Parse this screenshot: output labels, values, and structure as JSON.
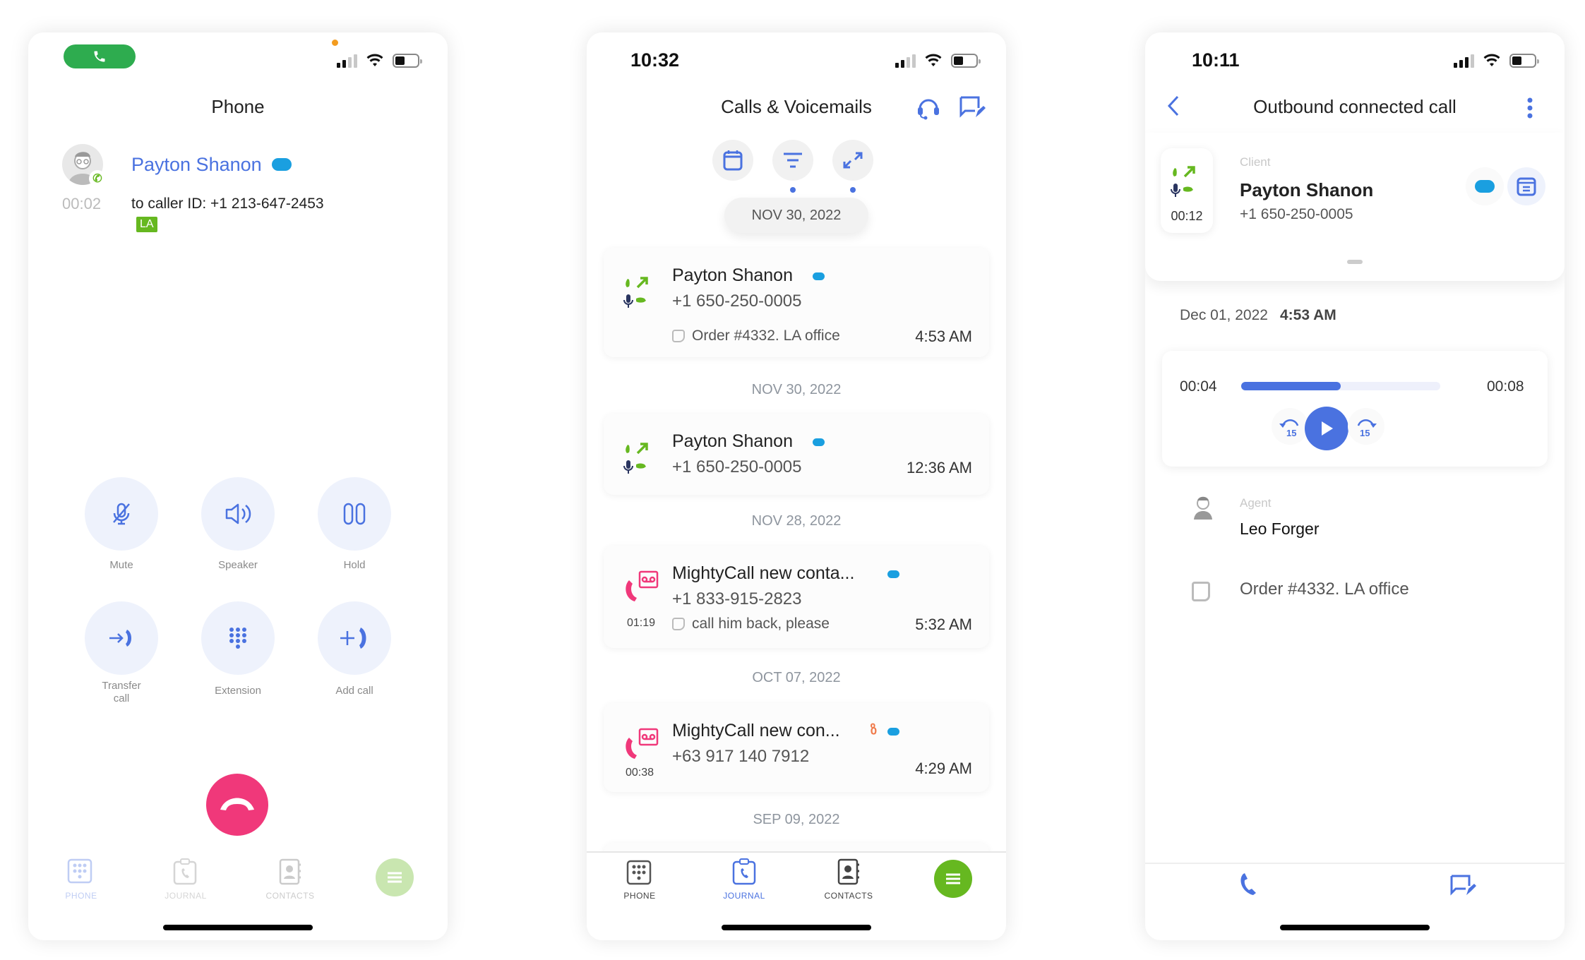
{
  "panel_call": {
    "status_bar": {
      "call_indicator": "phone-icon"
    },
    "title": "Phone",
    "contact": {
      "name": "Payton Shanon",
      "crm": "salesforce-icon",
      "duration": "00:02",
      "caller_id": "to caller ID: +1 213-647-2453",
      "tag": "LA"
    },
    "controls": [
      {
        "label": "Mute",
        "icon": "mic-off-icon"
      },
      {
        "label": "Speaker",
        "icon": "speaker-icon"
      },
      {
        "label": "Hold",
        "icon": "pause-icon"
      },
      {
        "label": "Transfer call",
        "icon": "transfer-icon"
      },
      {
        "label": "Extension",
        "icon": "keypad-icon"
      },
      {
        "label": "Add call",
        "icon": "add-call-icon"
      }
    ],
    "end_call": "hangup-icon",
    "tabs": [
      {
        "label": "PHONE"
      },
      {
        "label": "JOURNAL"
      },
      {
        "label": "CONTACTS"
      }
    ],
    "menu": "menu-icon"
  },
  "panel_journal": {
    "status_bar": {
      "time": "10:32"
    },
    "title": "Calls & Voicemails",
    "filters": [
      "calendar-icon",
      "filter-icon",
      "direction-icon"
    ],
    "sticky_date": "NOV 30, 2022",
    "items": [
      {
        "name": "Payton Shanon",
        "number": "+1 650-250-0005",
        "note": "Order #4332. LA office",
        "time": "4:53 AM",
        "type": "outbound-connected",
        "crm": [
          "salesforce"
        ]
      },
      {
        "date": "NOV 30, 2022",
        "name": "Payton Shanon",
        "number": "+1 650-250-0005",
        "time": "12:36 AM",
        "type": "outbound-connected",
        "crm": [
          "salesforce"
        ]
      },
      {
        "date": "NOV 28, 2022",
        "name": "MightyCall new conta...",
        "number": "+1 833-915-2823",
        "duration": "01:19",
        "note": "call him back, please",
        "time": "5:32 AM",
        "type": "voicemail",
        "crm": [
          "salesforce"
        ]
      },
      {
        "date": "OCT 07, 2022",
        "name": "MightyCall new con...",
        "number": "+63 917 140 7912",
        "duration": "00:38",
        "time": "4:29 AM",
        "type": "voicemail",
        "crm": [
          "hubspot",
          "salesforce"
        ]
      }
    ],
    "next_date": "SEP 09, 2022",
    "tabs": [
      {
        "label": "PHONE"
      },
      {
        "label": "JOURNAL",
        "active": true
      },
      {
        "label": "CONTACTS"
      }
    ]
  },
  "panel_detail": {
    "status_bar": {
      "time": "10:11"
    },
    "title": "Outbound connected call",
    "client": {
      "label": "Client",
      "name": "Payton Shanon",
      "number": "+1 650-250-0005",
      "duration": "00:12"
    },
    "date": "Dec 01, 2022",
    "time": "4:53 AM",
    "player": {
      "current": "00:04",
      "total": "00:08",
      "progress": 0.5,
      "skip_back": "15",
      "skip_forward": "15"
    },
    "agent": {
      "label": "Agent",
      "name": "Leo Forger"
    },
    "note": "Order #4332. LA office"
  },
  "colors": {
    "accent": "#4a72e0",
    "green": "#66b820",
    "pink": "#f0387a",
    "salesforce": "#1a9fe0"
  }
}
